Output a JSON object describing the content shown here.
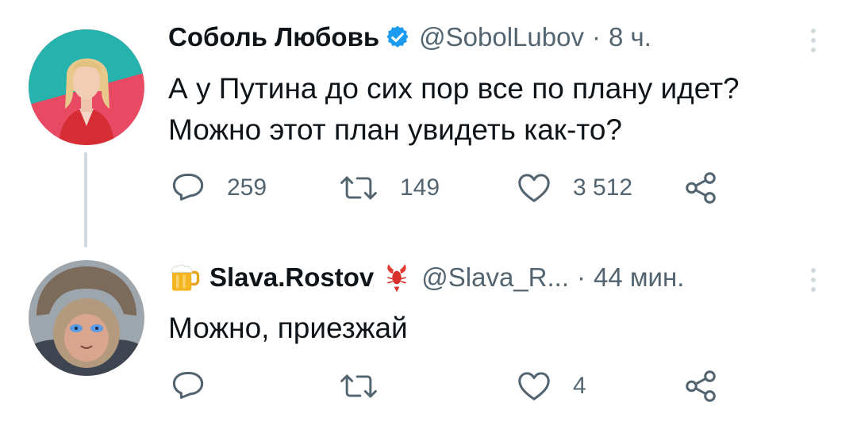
{
  "tweets": [
    {
      "display_name": "Соболь Любовь",
      "handle": "@SobolLubov",
      "separator": "·",
      "time": "8 ч.",
      "text_line1": "А у Путина до сих пор все по плану идет?",
      "text_line2": "Можно этот план увидеть как-то?",
      "replies": "259",
      "retweets": "149",
      "likes": "3 512",
      "verified": true
    },
    {
      "name_emoji": "beer-mug",
      "display_name": "Slava.Rostov",
      "name_emoji_after": "lobster",
      "handle": "@Slava_R...",
      "separator": "·",
      "time": "44 мин.",
      "text": "Можно, приезжай",
      "replies": "",
      "retweets": "",
      "likes": "4"
    }
  ],
  "colors": {
    "text_primary": "#0f1419",
    "text_secondary": "#536471",
    "verified_blue": "#1d9bf0",
    "thread_line": "#cfd9de"
  }
}
